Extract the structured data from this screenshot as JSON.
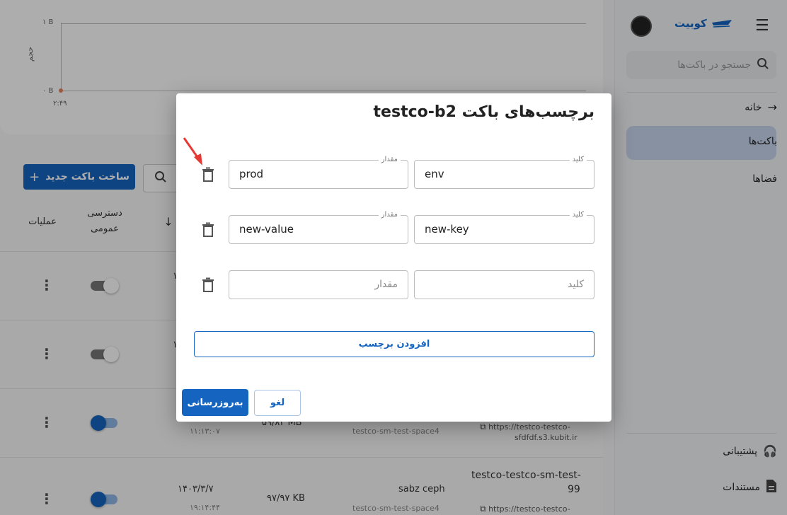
{
  "chart": {
    "y_top": "۱ B",
    "y_bottom": "۰ B",
    "y_title": "حجم",
    "x_tick": "۲:۴۹"
  },
  "toolbar": {
    "new_bucket": "ساخت باکت جدید",
    "new_bucket_icon": "plus-icon",
    "search_icon": "search-icon"
  },
  "table": {
    "headers": {
      "operations": "عملیات",
      "public_access": "دسترسی عمومی"
    },
    "rows": [
      {
        "public": "off",
        "date": "۱",
        "time": "",
        "size": "",
        "space": "",
        "url": "",
        "name": ""
      },
      {
        "public": "off",
        "date": "۱",
        "time": "",
        "size": "",
        "space": "",
        "url": "",
        "name": ""
      },
      {
        "public": "on",
        "date": "",
        "time": "۱۱:۱۳:۰۷",
        "size": "۵۹/۸۳ MB",
        "space": "testco-sm-test-space4",
        "url_line1": "https://testco-testco-",
        "url_line2": "sfdfdf.s3.kubit.ir",
        "name": ""
      },
      {
        "public": "on",
        "date": "۱۴۰۳/۳/۷",
        "time": "۱۹:۱۴:۴۴",
        "size": "۹۷/۹۷ KB",
        "owner": "sabz ceph",
        "space": "testco-sm-test-space4",
        "name_line1": "testco-testco-sm-test-",
        "name_line2": "99",
        "url_line1": "https://testco-testco-"
      }
    ]
  },
  "sidebar": {
    "brand": "کوبیت",
    "search_placeholder": "جستجو در باکت‌ها",
    "items": [
      {
        "label": "خانه",
        "icon": "arrow-right-icon"
      },
      {
        "label": "باکت‌ها",
        "icon": ""
      },
      {
        "label": "فضاها",
        "icon": ""
      }
    ],
    "bottom": [
      {
        "label": "پشتیبانی",
        "icon": "headset-icon"
      },
      {
        "label": "مستندات",
        "icon": "document-icon"
      }
    ]
  },
  "modal": {
    "title": "برچسب‌های باکت testco-b2",
    "key_label": "کلید",
    "value_label": "مقدار",
    "tags": [
      {
        "key": "env",
        "value": "prod"
      },
      {
        "key": "new-key",
        "value": "new-value"
      },
      {
        "key": "",
        "value": ""
      }
    ],
    "key_placeholder": "کلید",
    "value_placeholder": "مقدار",
    "add_tag": "افزودن برچسب",
    "update": "به‌روزرسانی",
    "cancel": "لغو"
  },
  "colors": {
    "accent": "#1565c0",
    "arrow": "#e53935"
  }
}
